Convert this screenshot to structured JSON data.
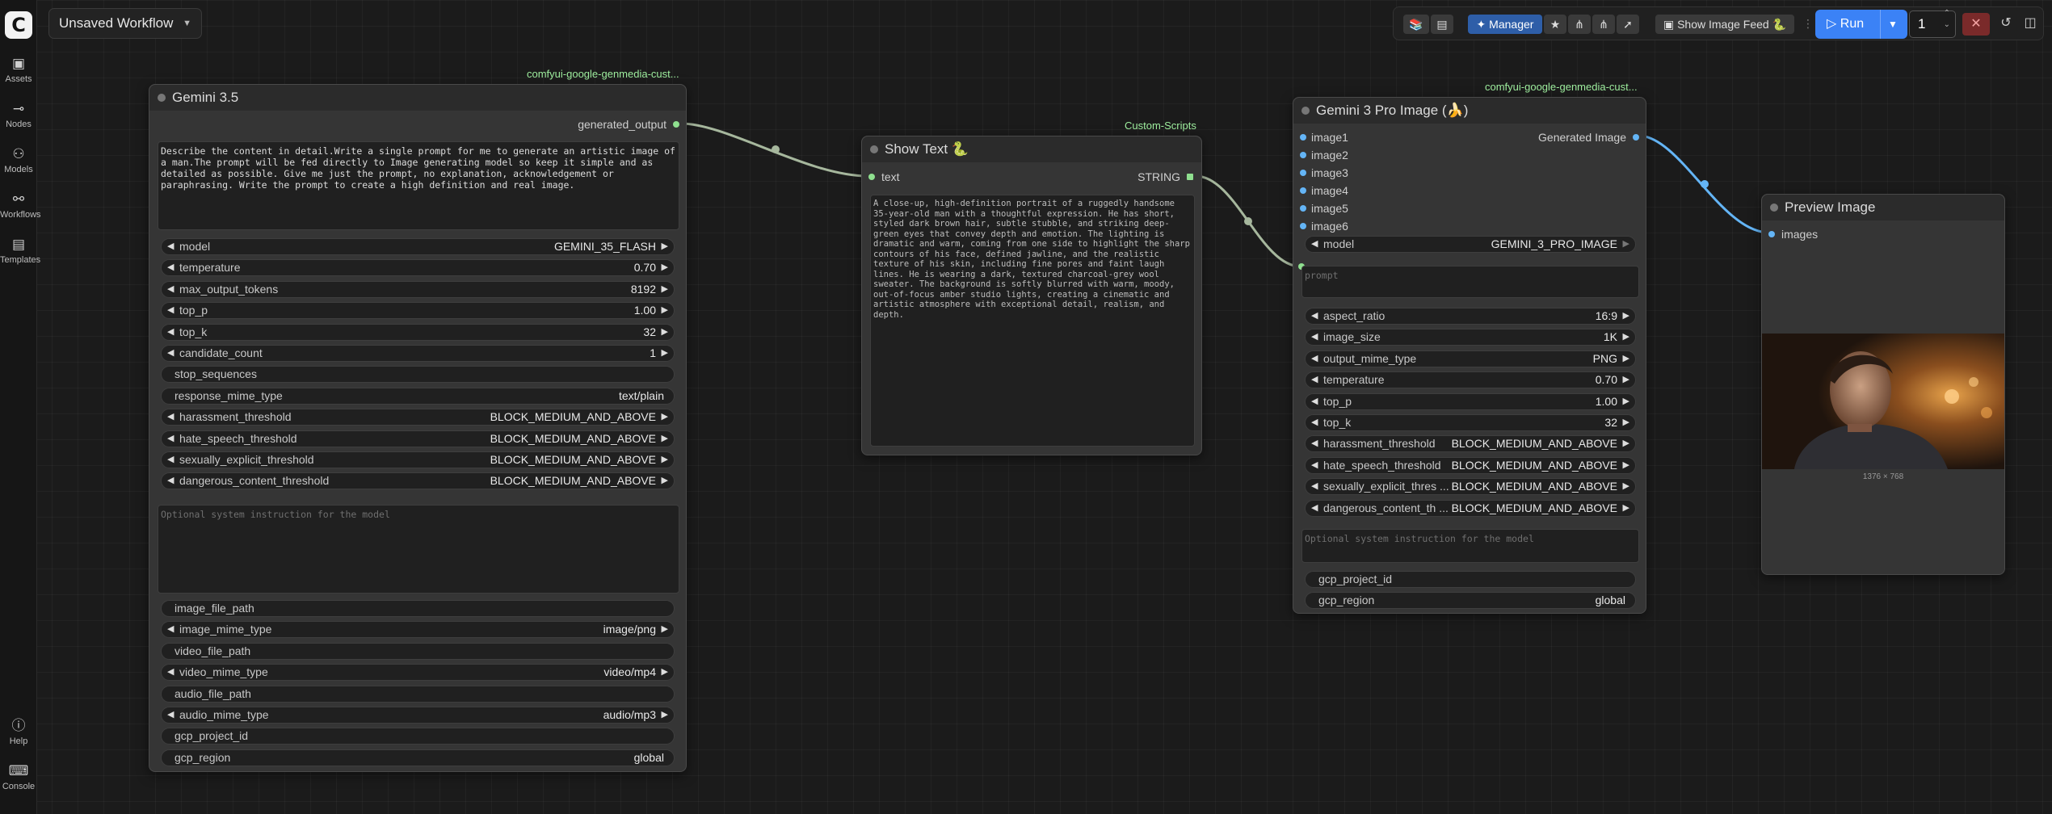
{
  "app": {
    "logo_letter": "C"
  },
  "sidebar": {
    "items": [
      {
        "label": "Assets",
        "icon": "image-icon"
      },
      {
        "label": "Nodes",
        "icon": "nodes-icon"
      },
      {
        "label": "Models",
        "icon": "models-icon"
      },
      {
        "label": "Workflows",
        "icon": "workflows-icon"
      },
      {
        "label": "Templates",
        "icon": "templates-icon"
      }
    ],
    "bottom": [
      {
        "label": "Help",
        "icon": "help-icon"
      },
      {
        "label": "Console",
        "icon": "console-icon"
      }
    ]
  },
  "workflow_tab": {
    "title": "Unsaved Workflow"
  },
  "topbar": {
    "manager_label": "Manager",
    "image_feed_label": "Show Image Feed 🐍",
    "run_label": "Run",
    "run_count": "1"
  },
  "nodes": {
    "gemini": {
      "title": "Gemini 3.5",
      "source": "comfyui-google-genmedia-cust...",
      "output": "generated_output",
      "prompt": "Describe the content in detail.Write a single prompt for me to generate an artistic image of a man.The prompt will be fed directly to Image generating model so keep it simple and as detailed as possible. Give me just the prompt, no explanation, acknowledgement or paraphrasing. Write the prompt to create a high definition and real image.",
      "widgets": [
        {
          "label": "model",
          "value": "GEMINI_35_FLASH",
          "arrows": true
        },
        {
          "label": "temperature",
          "value": "0.70",
          "arrows": true
        },
        {
          "label": "max_output_tokens",
          "value": "8192",
          "arrows": true
        },
        {
          "label": "top_p",
          "value": "1.00",
          "arrows": true
        },
        {
          "label": "top_k",
          "value": "32",
          "arrows": true
        },
        {
          "label": "candidate_count",
          "value": "1",
          "arrows": true
        },
        {
          "label": "stop_sequences",
          "value": "",
          "arrows": false
        },
        {
          "label": "response_mime_type",
          "value": "text/plain",
          "arrows": false
        },
        {
          "label": "harassment_threshold",
          "value": "BLOCK_MEDIUM_AND_ABOVE",
          "arrows": true
        },
        {
          "label": "hate_speech_threshold",
          "value": "BLOCK_MEDIUM_AND_ABOVE",
          "arrows": true
        },
        {
          "label": "sexually_explicit_threshold",
          "value": "BLOCK_MEDIUM_AND_ABOVE",
          "arrows": true
        },
        {
          "label": "dangerous_content_threshold",
          "value": "BLOCK_MEDIUM_AND_ABOVE",
          "arrows": true
        }
      ],
      "system_placeholder": "Optional system instruction for the model",
      "widgets2": [
        {
          "label": "image_file_path",
          "value": "",
          "arrows": false
        },
        {
          "label": "image_mime_type",
          "value": "image/png",
          "arrows": true
        },
        {
          "label": "video_file_path",
          "value": "",
          "arrows": false
        },
        {
          "label": "video_mime_type",
          "value": "video/mp4",
          "arrows": true
        },
        {
          "label": "audio_file_path",
          "value": "",
          "arrows": false
        },
        {
          "label": "audio_mime_type",
          "value": "audio/mp3",
          "arrows": true
        },
        {
          "label": "gcp_project_id",
          "value": "",
          "arrows": false
        },
        {
          "label": "gcp_region",
          "value": "global",
          "arrows": false
        }
      ]
    },
    "show_text": {
      "title": "Show Text 🐍",
      "source": "Custom-Scripts",
      "input": "text",
      "output": "STRING",
      "text": "A close-up, high-definition portrait of a ruggedly handsome 35-year-old man with a thoughtful expression. He has short, styled dark brown hair, subtle stubble, and striking deep-green eyes that convey depth and emotion. The lighting is dramatic and warm, coming from one side to highlight the sharp contours of his face, defined jawline, and the realistic texture of his skin, including fine pores and faint laugh lines. He is wearing a dark, textured charcoal-grey wool sweater. The background is softly blurred with warm, moody, out-of-focus amber studio lights, creating a cinematic and artistic atmosphere with exceptional detail, realism, and depth."
    },
    "gemini_image": {
      "title": "Gemini 3 Pro Image (🍌)",
      "source": "comfyui-google-genmedia-cust...",
      "inputs": [
        "image1",
        "image2",
        "image3",
        "image4",
        "image5",
        "image6"
      ],
      "output": "Generated Image",
      "model_label": "model",
      "model_value": "GEMINI_3_PRO_IMAGE",
      "prompt_placeholder": "prompt",
      "widgets": [
        {
          "label": "aspect_ratio",
          "value": "16:9",
          "arrows": true
        },
        {
          "label": "image_size",
          "value": "1K",
          "arrows": true
        },
        {
          "label": "output_mime_type",
          "value": "PNG",
          "arrows": true
        },
        {
          "label": "temperature",
          "value": "0.70",
          "arrows": true
        },
        {
          "label": "top_p",
          "value": "1.00",
          "arrows": true
        },
        {
          "label": "top_k",
          "value": "32",
          "arrows": true
        },
        {
          "label": "harassment_threshold",
          "value": "BLOCK_MEDIUM_AND_ABOVE",
          "arrows": true
        },
        {
          "label": "hate_speech_threshold",
          "value": "BLOCK_MEDIUM_AND_ABOVE",
          "arrows": true
        },
        {
          "label": "sexually_explicit_thres ...",
          "value": "BLOCK_MEDIUM_AND_ABOVE",
          "arrows": true
        },
        {
          "label": "dangerous_content_th ...",
          "value": "BLOCK_MEDIUM_AND_ABOVE",
          "arrows": true
        }
      ],
      "system_placeholder": "Optional system instruction for the model",
      "widgets2": [
        {
          "label": "gcp_project_id",
          "value": "",
          "arrows": false
        },
        {
          "label": "gcp_region",
          "value": "global",
          "arrows": false
        }
      ]
    },
    "preview": {
      "title": "Preview Image",
      "input": "images",
      "image_caption": "1376 × 768"
    }
  },
  "colors": {
    "wire_string": "#a6b79d",
    "wire_image": "#64b5f6",
    "source_label": "#9fef9f",
    "run_button": "#3b82f6"
  }
}
